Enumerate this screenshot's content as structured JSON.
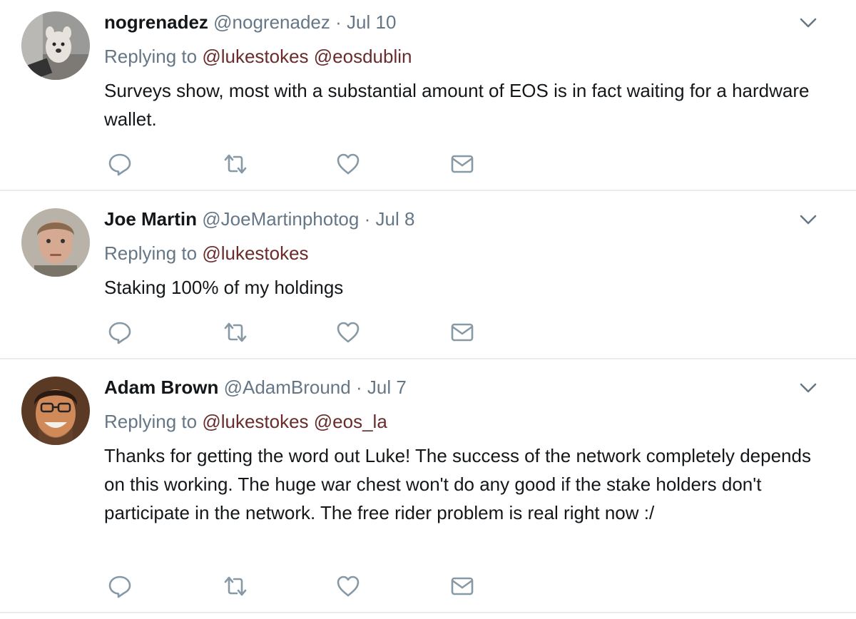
{
  "tweets": [
    {
      "name": "nogrenadez",
      "handle": "@nogrenadez",
      "separator": "·",
      "date": "Jul 10",
      "replying_to_label": "Replying to",
      "mentions": [
        "@lukestokes",
        "@eosdublin"
      ],
      "text": "Surveys show, most with a substantial amount of EOS is in fact waiting for a hardware wallet.",
      "avatar": "french-bulldog-avatar"
    },
    {
      "name": "Joe Martin",
      "handle": "@JoeMartinphotog",
      "separator": "·",
      "date": "Jul 8",
      "replying_to_label": "Replying to",
      "mentions": [
        "@lukestokes"
      ],
      "text": "Staking 100% of my holdings",
      "avatar": "man-portrait-avatar"
    },
    {
      "name": "Adam Brown",
      "handle": "@AdamBround",
      "separator": "·",
      "date": "Jul 7",
      "replying_to_label": "Replying to",
      "mentions": [
        "@lukestokes",
        "@eos_la"
      ],
      "text": "Thanks for getting the word out Luke!  The success of the network completely depends on this working.  The huge war chest won't do any good if the stake holders don't participate in the network.  The free rider problem is real right now :/",
      "avatar": "smiling-man-glasses-avatar"
    }
  ],
  "icons": {
    "reply": "reply-icon",
    "retweet": "retweet-icon",
    "like": "heart-icon",
    "dm": "envelope-icon",
    "more": "chevron-down-icon"
  },
  "colors": {
    "text": "#14171a",
    "secondary": "#657786",
    "mention": "#6a2b2b",
    "icon": "#8899a6",
    "divider": "#e6ecf0"
  }
}
